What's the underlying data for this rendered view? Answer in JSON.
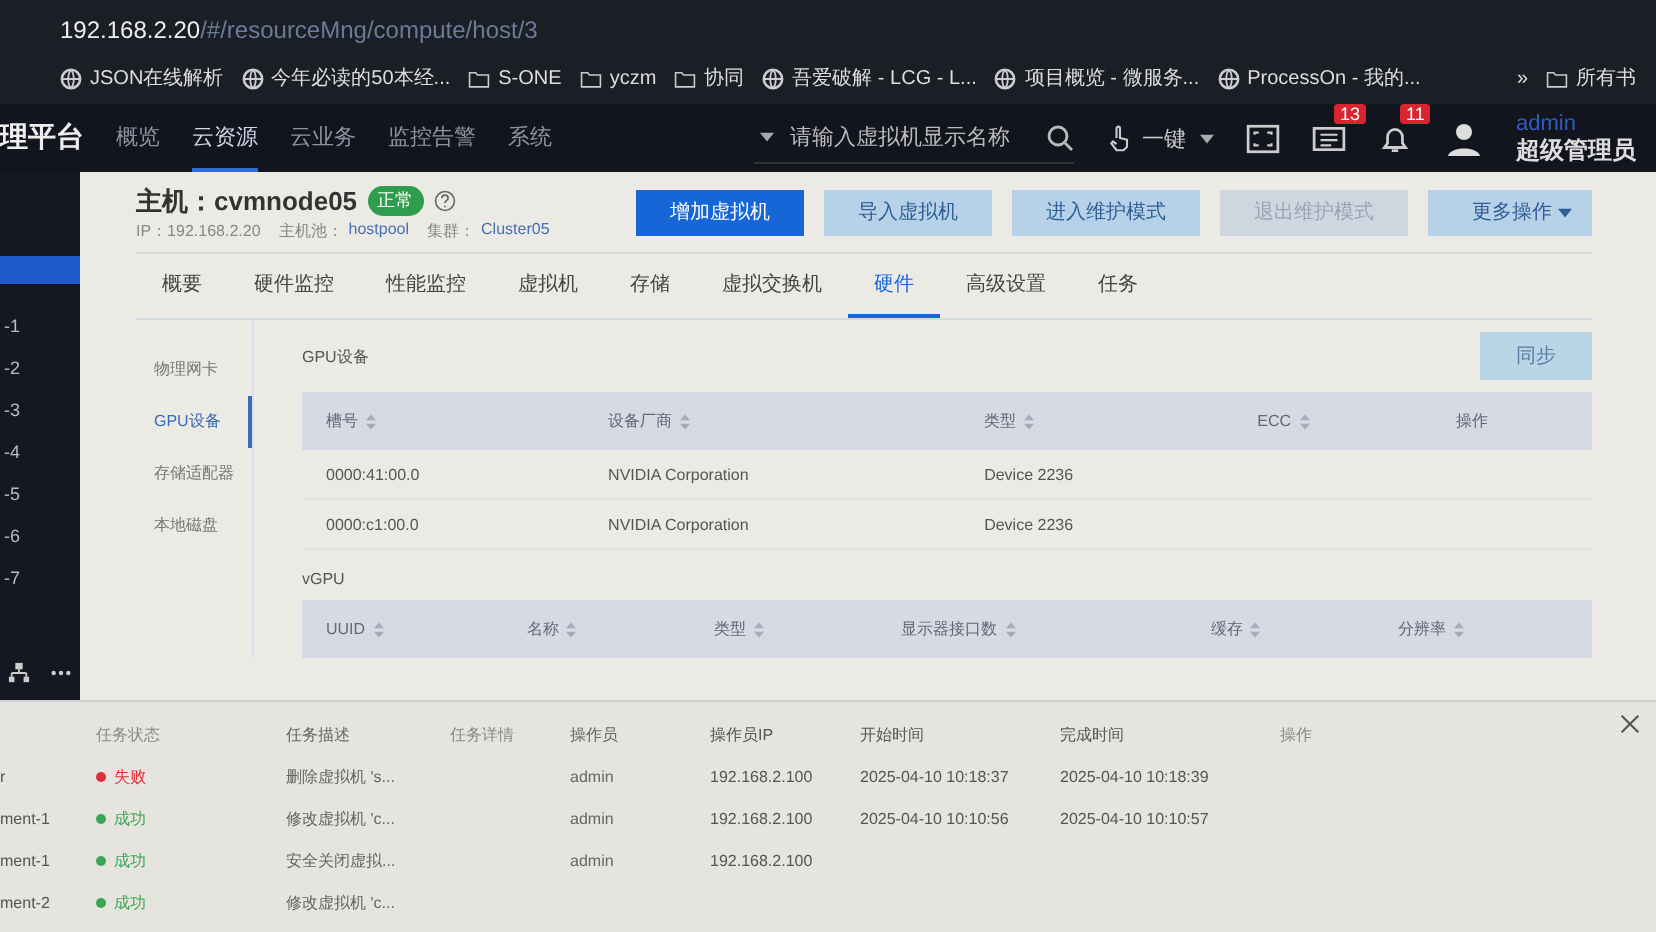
{
  "browser": {
    "address_host": "192.168.2.20",
    "address_path": "/#/resourceMng/compute/host/3",
    "bookmarks": [
      {
        "kind": "site",
        "label": "JSON在线解析"
      },
      {
        "kind": "site",
        "label": "今年必读的50本经..."
      },
      {
        "kind": "folder",
        "label": "S-ONE"
      },
      {
        "kind": "folder",
        "label": "yczm"
      },
      {
        "kind": "folder",
        "label": "协同"
      },
      {
        "kind": "site",
        "label": "吾爱破解 - LCG - L..."
      },
      {
        "kind": "site",
        "label": "项目概览 - 微服务..."
      },
      {
        "kind": "site",
        "label": "ProcessOn - 我的..."
      }
    ],
    "more": "»",
    "all_bookmarks": "所有书"
  },
  "header": {
    "brand": "理平台",
    "nav": [
      {
        "label": "概览",
        "selected": false
      },
      {
        "label": "云资源",
        "selected": true
      },
      {
        "label": "云业务",
        "selected": false
      },
      {
        "label": "监控告警",
        "selected": false
      },
      {
        "label": "系统",
        "selected": false
      }
    ],
    "search": {
      "placeholder": "请输入虚拟机显示名称"
    },
    "one_click": "一键",
    "messages_badge": "13",
    "alerts_badge": "11",
    "user": {
      "name": "admin",
      "role": "超级管理员"
    }
  },
  "sidebar": {
    "items": [
      {
        "selected": true
      },
      {
        "label": "-1",
        "selected": false
      },
      {
        "label": "-2",
        "selected": false
      },
      {
        "label": "-3",
        "selected": false
      },
      {
        "label": "-4",
        "selected": false
      },
      {
        "label": "-5",
        "selected": false
      },
      {
        "label": "-6",
        "selected": false
      },
      {
        "label": "-7",
        "selected": false
      }
    ]
  },
  "host": {
    "title": "主机：cvmnode05",
    "status": "正常",
    "ip": "IP：192.168.2.20",
    "pool_label": "主机池：",
    "pool": "hostpool",
    "cluster_label": "集群：",
    "cluster": "Cluster05",
    "buttons": [
      {
        "label": "增加虚拟机",
        "kind": "primary",
        "disabled": false
      },
      {
        "label": "导入虚拟机",
        "kind": "default",
        "disabled": false
      },
      {
        "label": "进入维护模式",
        "kind": "default",
        "disabled": false
      },
      {
        "label": "退出维护模式",
        "kind": "default",
        "disabled": true
      },
      {
        "label": "更多操作",
        "kind": "dropdown",
        "disabled": false
      }
    ]
  },
  "tabs": [
    {
      "label": "概要",
      "selected": false
    },
    {
      "label": "硬件监控",
      "selected": false
    },
    {
      "label": "性能监控",
      "selected": false
    },
    {
      "label": "虚拟机",
      "selected": false
    },
    {
      "label": "存储",
      "selected": false
    },
    {
      "label": "虚拟交换机",
      "selected": false
    },
    {
      "label": "硬件",
      "selected": true
    },
    {
      "label": "高级设置",
      "selected": false
    },
    {
      "label": "任务",
      "selected": false
    }
  ],
  "hardware_menu": [
    {
      "label": "物理网卡",
      "selected": false
    },
    {
      "label": "GPU设备",
      "selected": true
    },
    {
      "label": "存储适配器",
      "selected": false
    },
    {
      "label": "本地磁盘",
      "selected": false
    }
  ],
  "gpu": {
    "title": "GPU设备",
    "sync_button": "同步",
    "columns": [
      {
        "label": "槽号",
        "sortable": true
      },
      {
        "label": "设备厂商",
        "sortable": true
      },
      {
        "label": "类型",
        "sortable": true
      },
      {
        "label": "ECC",
        "sortable": true
      },
      {
        "label": "操作",
        "sortable": false
      }
    ],
    "rows": [
      {
        "slot": "0000:41:00.0",
        "vendor": "NVIDIA Corporation",
        "type": "Device 2236"
      },
      {
        "slot": "0000:c1:00.0",
        "vendor": "NVIDIA Corporation",
        "type": "Device 2236"
      }
    ]
  },
  "vgpu": {
    "title": "vGPU",
    "columns": [
      {
        "label": "UUID",
        "sortable": true
      },
      {
        "label": "名称",
        "sortable": true
      },
      {
        "label": "类型",
        "sortable": true
      },
      {
        "label": "显示器接口数",
        "sortable": true
      },
      {
        "label": "缓存",
        "sortable": true
      },
      {
        "label": "分辨率",
        "sortable": true
      }
    ]
  },
  "task_panel": {
    "columns": [
      "任务状态",
      "任务描述",
      "任务详情",
      "操作员",
      "操作员IP",
      "开始时间",
      "完成时间",
      "操作"
    ],
    "rows": [
      {
        "target": "r",
        "status": "失败",
        "color": "#e0303a",
        "description": "删除虚拟机 's...",
        "operator": "admin",
        "ip": "192.168.2.100",
        "start": "2025-04-10 10:18:37",
        "end": "2025-04-10 10:18:39"
      },
      {
        "target": "ment-1",
        "status": "成功",
        "color": "#3aa655",
        "description": "修改虚拟机 'c...",
        "operator": "admin",
        "ip": "192.168.2.100",
        "start": "2025-04-10 10:10:56",
        "end": "2025-04-10 10:10:57"
      },
      {
        "target": "ment-1",
        "status": "成功",
        "color": "#3aa655",
        "description": "安全关闭虚拟...",
        "operator": "admin",
        "ip": "192.168.2.100"
      },
      {
        "target": "ment-2",
        "status": "成功",
        "color": "#3aa655",
        "description": "修改虚拟机 'c..."
      }
    ]
  }
}
